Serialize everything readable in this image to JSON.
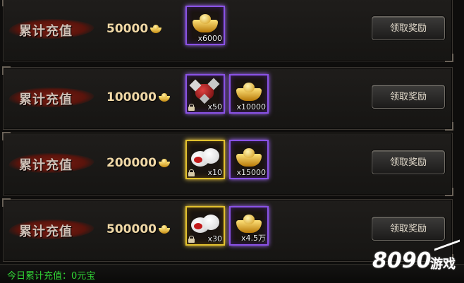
{
  "rows": [
    {
      "label": "累计充值",
      "amount": "50000",
      "rewards": [
        {
          "icon": "gold-ingot-icon",
          "count": "x6000",
          "frame": "purple",
          "locked": false
        }
      ],
      "button": "领取奖励"
    },
    {
      "label": "累计充值",
      "amount": "100000",
      "rewards": [
        {
          "icon": "gear-item-icon",
          "count": "x50",
          "frame": "purple",
          "locked": true
        },
        {
          "icon": "gold-ingot-icon",
          "count": "x10000",
          "frame": "purple",
          "locked": false
        }
      ],
      "button": "领取奖励"
    },
    {
      "label": "累计充值",
      "amount": "200000",
      "rewards": [
        {
          "icon": "white-fruit-icon",
          "count": "x10",
          "frame": "gold",
          "locked": true
        },
        {
          "icon": "gold-ingot-icon",
          "count": "x15000",
          "frame": "purple",
          "locked": false
        }
      ],
      "button": "领取奖励"
    },
    {
      "label": "累计充值",
      "amount": "500000",
      "rewards": [
        {
          "icon": "white-fruit-icon",
          "count": "x30",
          "frame": "gold",
          "locked": true
        },
        {
          "icon": "gold-ingot-icon",
          "count": "x4.5万",
          "frame": "purple",
          "locked": false
        }
      ],
      "button": "领取奖励"
    }
  ],
  "footer": {
    "text": "今日累计充值：0元宝"
  },
  "watermark": {
    "number": "8090",
    "text": "游戏"
  },
  "colors": {
    "purple_frame": "#8a52e6",
    "gold_frame": "#e3c22e",
    "footer_text": "#32d636"
  }
}
